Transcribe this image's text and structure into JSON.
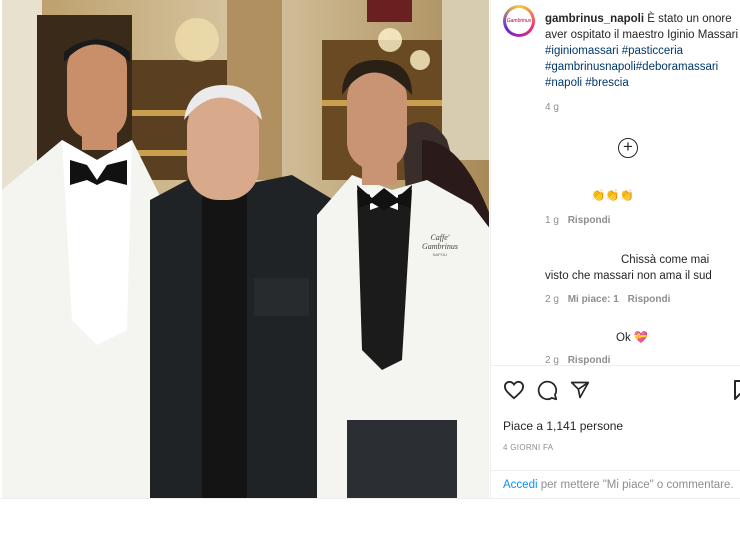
{
  "post": {
    "username": "gambrinus_napoli",
    "avatar_text": "Gambrinus",
    "caption_text": " È stato un onore aver ospitato il maestro Iginio Massari",
    "hashtags": "#iginiomassari #pasticceria #gambrinusnapoli#deboramassari #napoli #brescia",
    "caption_age": "4 g"
  },
  "photo": {
    "jacket_logo_line1": "Caffe'",
    "jacket_logo_line2": "Gambrinus",
    "jacket_logo_line3": "NAPOLI"
  },
  "comments": [
    {
      "text": "👏👏👏",
      "age": "1 g",
      "reply": "Rispondi",
      "likes": ""
    },
    {
      "text": "Chissà come mai visto che massari non ama il sud",
      "age": "2 g",
      "likes": "Mi piace: 1",
      "reply": "Rispondi"
    },
    {
      "text": "Ok 💝",
      "age": "2 g",
      "reply": "Rispondi",
      "likes": ""
    }
  ],
  "actions": {
    "likes_text": "Piace a 1,141 persone",
    "time_ago": "4 GIORNI FA",
    "login_link": "Accedi",
    "login_rest": " per mettere \"Mi piace\" o commentare."
  },
  "colors": {
    "link": "#0095f6",
    "hashtag": "#00376b",
    "muted": "#8e8e8e"
  }
}
